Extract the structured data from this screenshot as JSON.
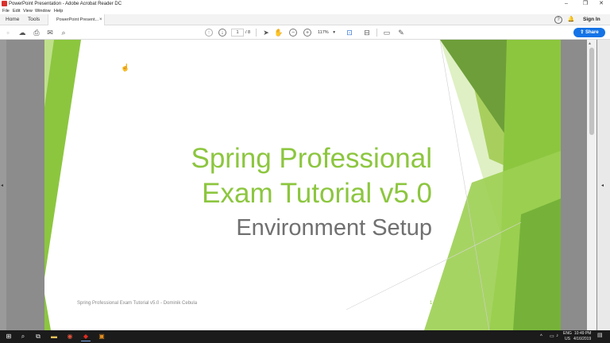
{
  "window": {
    "title": "PowerPoint Presentation - Adobe Acrobat Reader DC",
    "controls": [
      "–",
      "❐",
      "✕"
    ]
  },
  "menu": [
    "File",
    "Edit",
    "View",
    "Window",
    "Help"
  ],
  "tabs": {
    "home": "Home",
    "tools": "Tools",
    "document": "PowerPoint Present...",
    "close": "×",
    "help_icon": "?",
    "bell_icon": "🔔",
    "sign_in": "Sign In"
  },
  "toolbar": {
    "page_current": "1",
    "page_total": "/ 8",
    "zoom": "117%",
    "share": "Share"
  },
  "slide": {
    "title_line1": "Spring Professional",
    "title_line2": "Exam Tutorial v5.0",
    "subtitle": "Environment Setup",
    "footer": "Spring Professional Exam Tutorial v5.0 - Dominik Cebula",
    "page_number": "1",
    "accent_color": "#8cc63f"
  },
  "taskbar": {
    "lang_line1": "ENG",
    "lang_line2": "US",
    "time": "10:49 PM",
    "date": "4/16/2019"
  }
}
